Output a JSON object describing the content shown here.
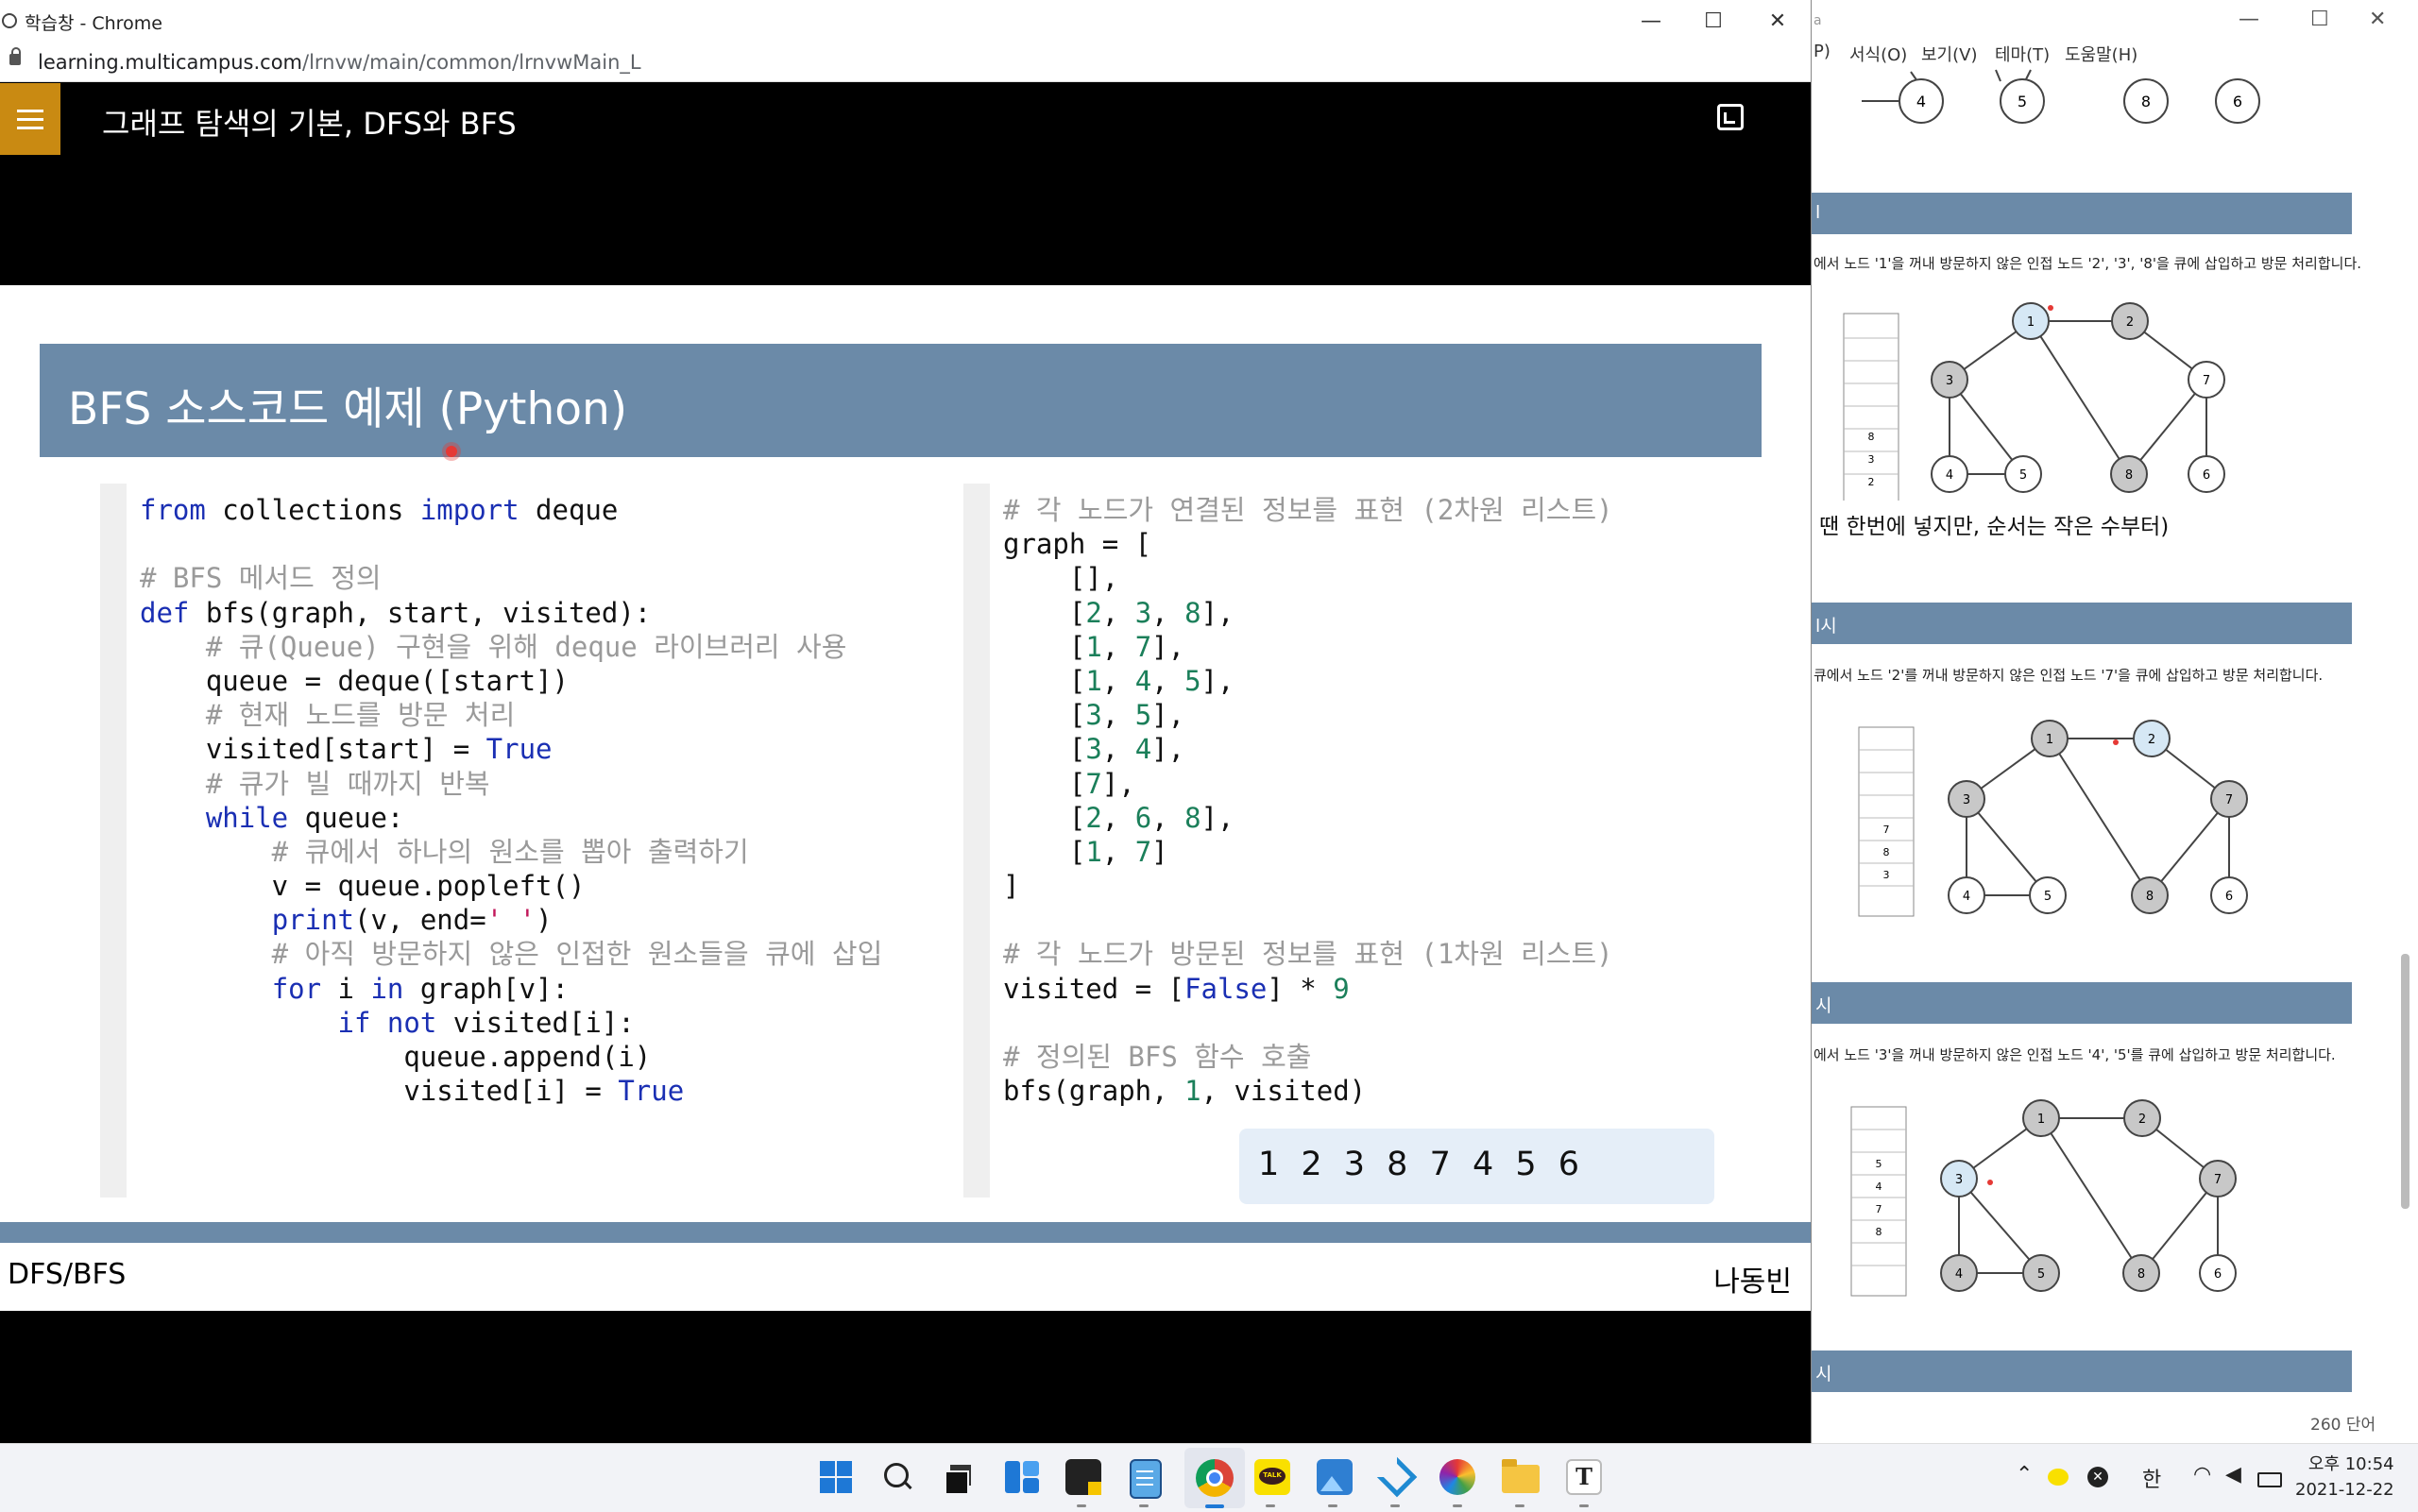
{
  "chrome": {
    "window_title": "학습창 - Chrome",
    "url_host": "learning.multicampus.com",
    "url_path": "/lrnvw/main/common/lrnvwMain_L",
    "controls": {
      "minimize": "—",
      "maximize": "☐",
      "close": "✕"
    }
  },
  "page": {
    "title": "그래프 탐색의 기본, DFS와 BFS",
    "menu_icon": "hamburger-icon",
    "expand_icon": "fullscreen-icon"
  },
  "slide": {
    "heading": "BFS 소스코드 예제 (Python)",
    "code_left": [
      "from collections import deque",
      "",
      "# BFS 메서드 정의",
      "def bfs(graph, start, visited):",
      "    # 큐(Queue) 구현을 위해 deque 라이브러리 사용",
      "    queue = deque([start])",
      "    # 현재 노드를 방문 처리",
      "    visited[start] = True",
      "    # 큐가 빌 때까지 반복",
      "    while queue:",
      "        # 큐에서 하나의 원소를 뽑아 출력하기",
      "        v = queue.popleft()",
      "        print(v, end=' ')",
      "        # 아직 방문하지 않은 인접한 원소들을 큐에 삽입",
      "        for i in graph[v]:",
      "            if not visited[i]:",
      "                queue.append(i)",
      "                visited[i] = True"
    ],
    "code_right": [
      "# 각 노드가 연결된 정보를 표현 (2차원 리스트)",
      "graph = [",
      "    [],",
      "    [2, 3, 8],",
      "    [1, 7],",
      "    [1, 4, 5],",
      "    [3, 5],",
      "    [3, 4],",
      "    [7],",
      "    [2, 6, 8],",
      "    [1, 7]",
      "]",
      "",
      "# 각 노드가 방문된 정보를 표현 (1차원 리스트)",
      "visited = [False] * 9",
      "",
      "# 정의된 BFS 함수 호출",
      "bfs(graph, 1, visited)"
    ],
    "output": "1 2 3 8 7 4 5 6",
    "footer_left": "DFS/BFS",
    "footer_right": "나동빈"
  },
  "word": {
    "title_fragment": "a",
    "menu": [
      "P)",
      "서식(O)",
      "보기(V)",
      "테마(T)",
      "도움말(H)"
    ],
    "top_nodes": [
      "4",
      "5",
      "8",
      "6"
    ],
    "bars": [
      "l",
      "l시",
      "시",
      "시"
    ],
    "caption1": "에서 노드 '1'을 꺼내 방문하지 않은 인접 노드 '2', '3', '8'을 큐에 삽입하고 방문 처리합니다.",
    "note1": "땐 한번에 넣지만, 순서는 작은 수부터)",
    "caption2": "큐에서 노드 '2'를 꺼내 방문하지 않은 인접 노드 '7'을 큐에 삽입하고 방문 처리합니다.",
    "caption3": "에서 노드 '3'을 꺼내 방문하지 않은 인접 노드 '4', '5'를 큐에 삽입하고 방문 처리합니다.",
    "graph_nodes": [
      "1",
      "2",
      "3",
      "4",
      "5",
      "6",
      "7",
      "8"
    ],
    "queue1": [
      "8",
      "3",
      "2"
    ],
    "queue2": [
      "7",
      "8",
      "3"
    ],
    "queue3": [
      "5",
      "4",
      "7",
      "8"
    ],
    "status": "260 단어"
  },
  "taskbar": {
    "apps": [
      "start-icon",
      "search-icon",
      "task-view-icon",
      "widgets-icon",
      "sticky-notes-icon",
      "notepad-icon",
      "chrome-icon",
      "kakaotalk-icon",
      "photos-icon",
      "vscode-icon",
      "paint-icon",
      "file-explorer-icon",
      "typora-icon"
    ],
    "kakao_label": "TALK",
    "typora_label": "T",
    "ime": "한",
    "time": "오후 10:54",
    "date": "2021-12-22"
  },
  "colors": {
    "banner": "#6b8aa8",
    "menu_button": "#c98a12",
    "output_bg": "#e5eef8",
    "keyword": "#1a2fb3",
    "comment": "#9a9a9a",
    "number": "#1b7f5a"
  }
}
